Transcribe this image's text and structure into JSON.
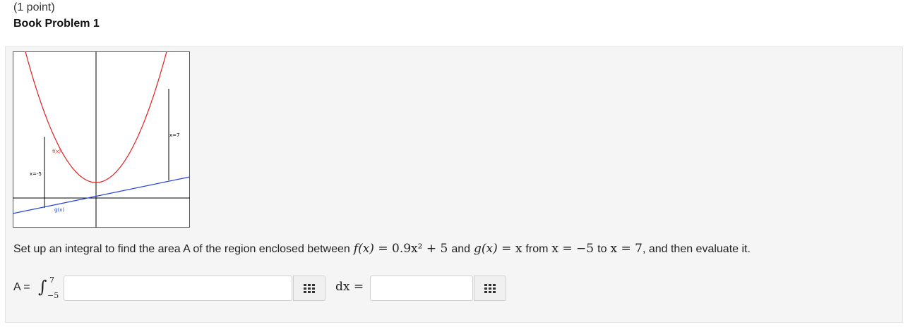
{
  "header": {
    "points": "(1 point)",
    "title": "Book Problem 1"
  },
  "graph": {
    "label_f": "f(x)",
    "label_g": "g(x)",
    "label_left": "x=-5",
    "label_right": "x=7",
    "colors": {
      "f": "#e02020",
      "g": "#2040e0",
      "axes": "#000000"
    }
  },
  "question": {
    "part1": "Set up an integral to find the area A of the region enclosed between",
    "f_lhs": "f(x)",
    "f_rhs": "= 0.9x² + 5",
    "and": "and",
    "g_lhs": "g(x)",
    "g_rhs": "= x",
    "from": "from",
    "x_from": "x = −5",
    "to": "to",
    "x_to": "x = 7",
    "part_end": ", and then evaluate it."
  },
  "answer": {
    "label": "A =",
    "integral_symbol": "∫",
    "upper_limit": "7",
    "lower_limit": "−5",
    "integrand_value": "",
    "dx_label": "dx =",
    "result_value": "",
    "palette_icon": "grid-icon"
  }
}
